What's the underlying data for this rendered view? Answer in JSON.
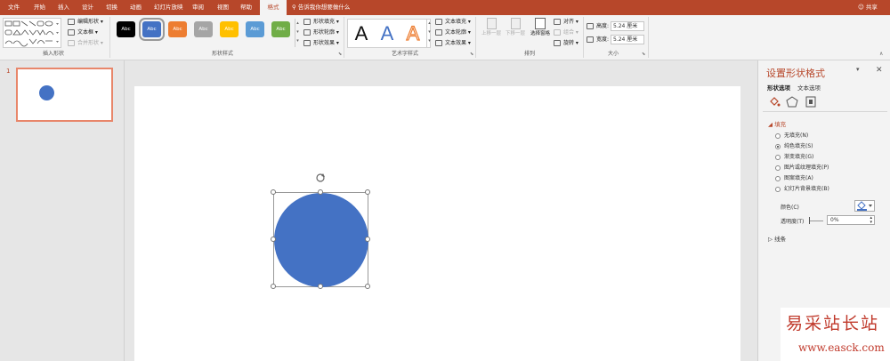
{
  "tabs": [
    {
      "label": "文件"
    },
    {
      "label": "开始"
    },
    {
      "label": "插入"
    },
    {
      "label": "设计"
    },
    {
      "label": "切换"
    },
    {
      "label": "动画"
    },
    {
      "label": "幻灯片放映"
    },
    {
      "label": "审阅"
    },
    {
      "label": "视图"
    },
    {
      "label": "帮助"
    },
    {
      "label": "格式"
    }
  ],
  "tell_me": "告诉我你想要做什么",
  "share": "共享",
  "ribbon": {
    "insert_shapes": {
      "edit_shape": "编辑形状",
      "text_box": "文本框",
      "merge_shapes": "合并形状",
      "label": "插入形状"
    },
    "shape_styles": {
      "swatches": [
        {
          "text": "Abc",
          "color": "#000000"
        },
        {
          "text": "Abc",
          "color": "#4472c4"
        },
        {
          "text": "Abc",
          "color": "#ed7d31"
        },
        {
          "text": "Abc",
          "color": "#a5a5a5"
        },
        {
          "text": "Abc",
          "color": "#ffc000"
        },
        {
          "text": "Abc",
          "color": "#5b9bd5"
        },
        {
          "text": "Abc",
          "color": "#70ad47"
        }
      ],
      "fill": "形状填充",
      "outline": "形状轮廓",
      "effects": "形状效果",
      "label": "形状样式"
    },
    "wordart": {
      "letters": [
        {
          "text": "A",
          "color": "#111111"
        },
        {
          "text": "A",
          "color": "#4472c4"
        },
        {
          "text": "A",
          "color": "#f4b183"
        }
      ],
      "text_fill": "文本填充",
      "text_outline": "文本轮廓",
      "text_effects": "文本效果",
      "label": "艺术字样式"
    },
    "arrange": {
      "bring_forward": "上移一层",
      "send_backward": "下移一层",
      "selection_pane": "选择窗格",
      "align": "对齐",
      "group": "组合",
      "rotate": "旋转",
      "label": "排列"
    },
    "size": {
      "height_label": "高度:",
      "height_value": "5.24 厘米",
      "width_label": "宽度:",
      "width_value": "5.24 厘米",
      "label": "大小"
    }
  },
  "slides": [
    {
      "number": "1"
    }
  ],
  "colors": {
    "accent": "#b7472a",
    "shape_fill": "#4472c4"
  },
  "format_pane": {
    "title": "设置形状格式",
    "tab_shape": "形状选项",
    "tab_text": "文本选项",
    "fill_section": "填充",
    "fill_options": [
      {
        "label": "无填充(N)",
        "selected": false
      },
      {
        "label": "纯色填充(S)",
        "selected": true
      },
      {
        "label": "渐变填充(G)",
        "selected": false
      },
      {
        "label": "图片或纹理填充(P)",
        "selected": false
      },
      {
        "label": "图案填充(A)",
        "selected": false
      },
      {
        "label": "幻灯片背景填充(B)",
        "selected": false
      }
    ],
    "color_label": "颜色(C)",
    "transparency_label": "透明度(T)",
    "transparency_value": "0%",
    "line_section": "线条"
  },
  "watermark": {
    "text": "易采站长站",
    "url": "www.easck.com"
  }
}
